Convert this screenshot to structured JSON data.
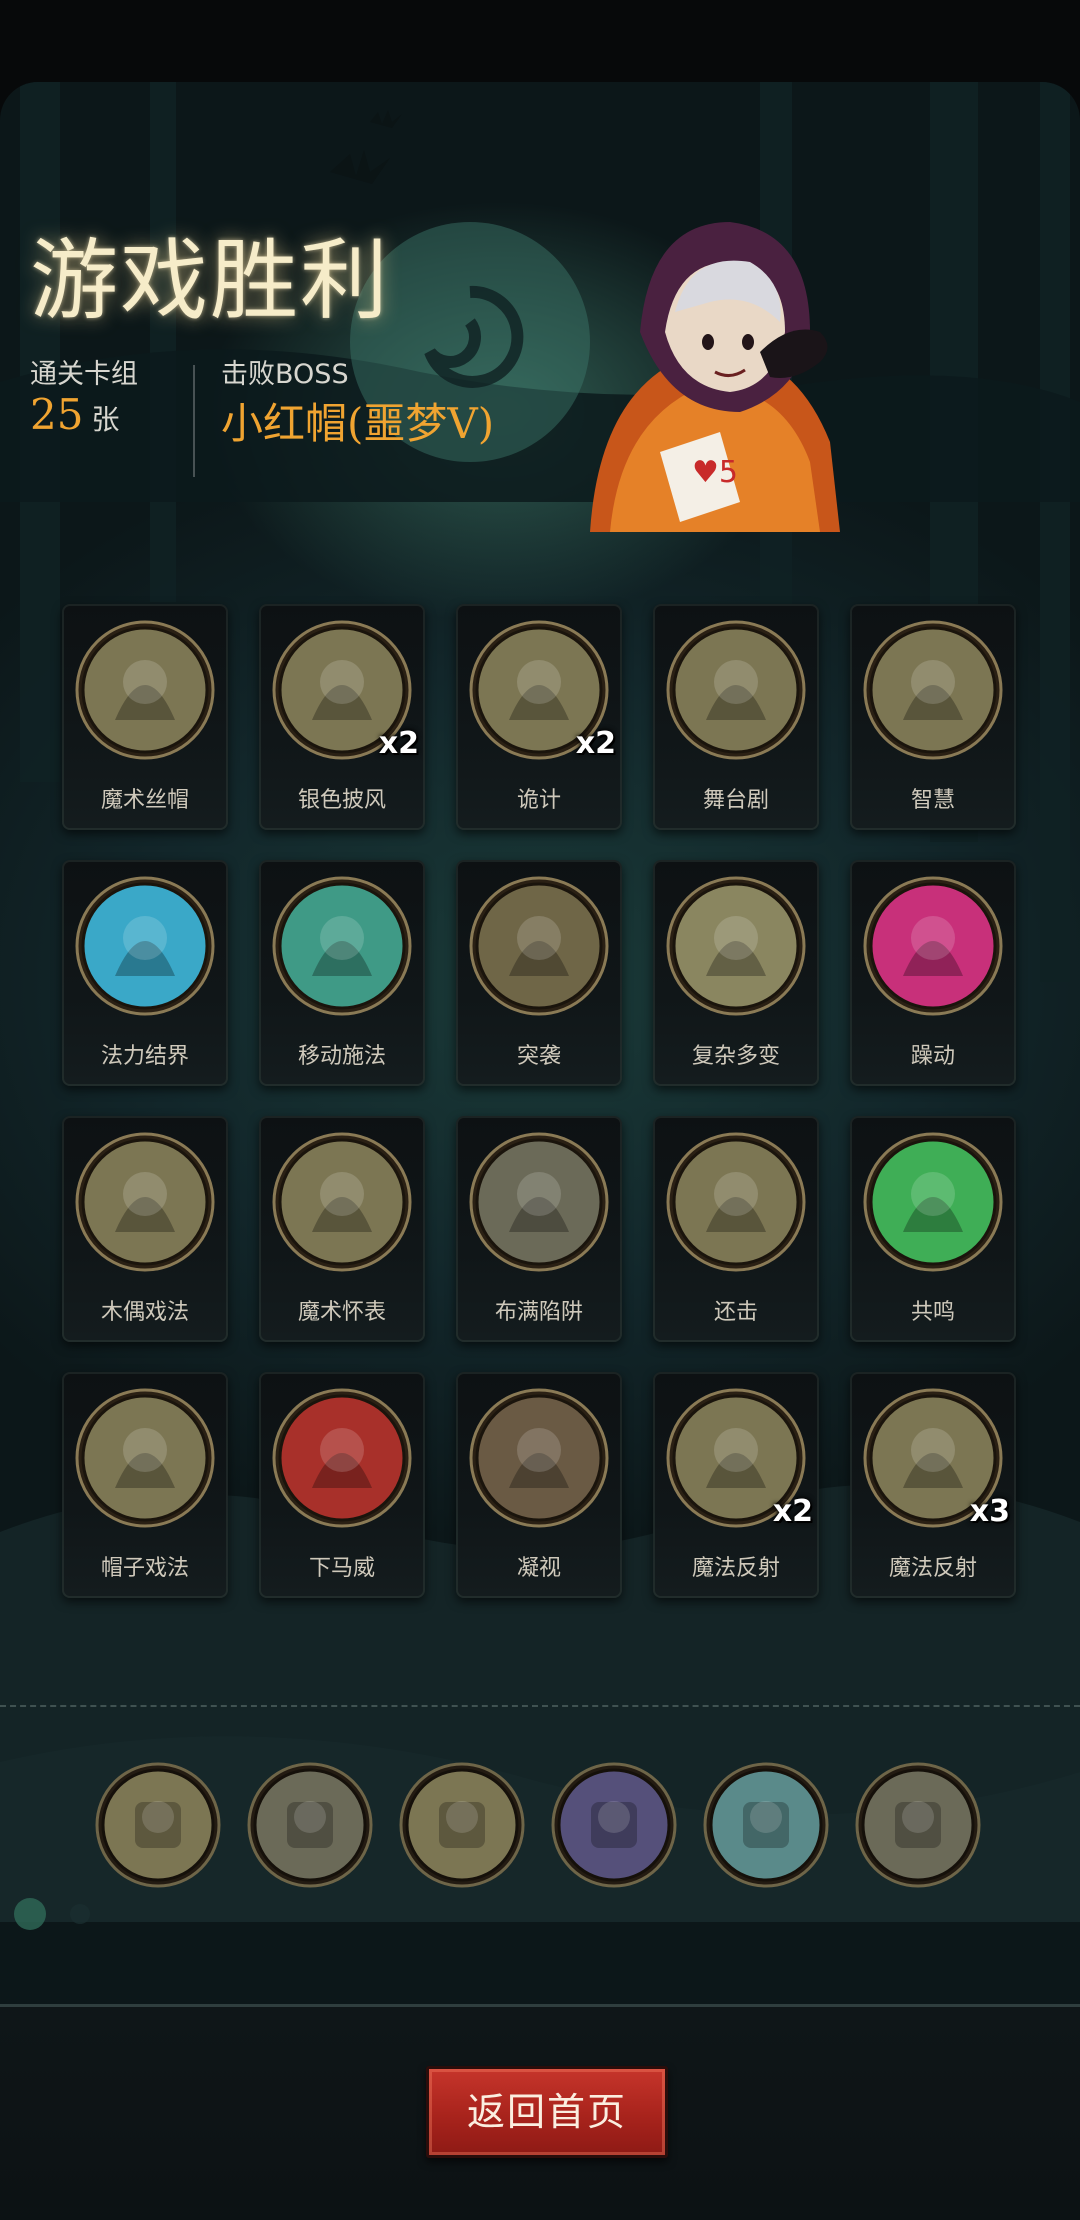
{
  "header": {
    "title": "游戏胜利",
    "deck_label": "通关卡组",
    "deck_count": "25",
    "deck_unit": "张",
    "boss_label": "击败BOSS",
    "boss_name": "小红帽(噩梦V)"
  },
  "cards": [
    {
      "name": "魔术丝帽",
      "multiplier": "",
      "icon": "top-hat-clock-icon",
      "bg": "#7c7653"
    },
    {
      "name": "银色披风",
      "multiplier": "x2",
      "icon": "purple-cloak-icon",
      "bg": "#7c7653"
    },
    {
      "name": "诡计",
      "multiplier": "x2",
      "icon": "card-trickster-icon",
      "bg": "#7c7653"
    },
    {
      "name": "舞台剧",
      "multiplier": "",
      "icon": "stage-play-icon",
      "bg": "#7c7653"
    },
    {
      "name": "智慧",
      "multiplier": "",
      "icon": "scholar-icon",
      "bg": "#7c7653"
    },
    {
      "name": "法力结界",
      "multiplier": "",
      "icon": "mana-barrier-icon",
      "bg": "#3aa8c8"
    },
    {
      "name": "移动施法",
      "multiplier": "",
      "icon": "wizard-casting-icon",
      "bg": "#3f9a86"
    },
    {
      "name": "突袭",
      "multiplier": "",
      "icon": "ambush-icon",
      "bg": "#6f6647"
    },
    {
      "name": "复杂多变",
      "multiplier": "",
      "icon": "green-cube-icon",
      "bg": "#8a8660"
    },
    {
      "name": "躁动",
      "multiplier": "",
      "icon": "restless-energy-icon",
      "bg": "#c8307a"
    },
    {
      "name": "木偶戏法",
      "multiplier": "",
      "icon": "puppet-icon",
      "bg": "#7c7653"
    },
    {
      "name": "魔术怀表",
      "multiplier": "",
      "icon": "pocket-watch-icon",
      "bg": "#7c7653"
    },
    {
      "name": "布满陷阱",
      "multiplier": "",
      "icon": "spike-trap-icon",
      "bg": "#6b6a58"
    },
    {
      "name": "还击",
      "multiplier": "",
      "icon": "counterattack-icon",
      "bg": "#7c7653"
    },
    {
      "name": "共鸣",
      "multiplier": "",
      "icon": "resonance-skulls-icon",
      "bg": "#3fae56"
    },
    {
      "name": "帽子戏法",
      "multiplier": "",
      "icon": "rabbit-hat-icon",
      "bg": "#7c7653"
    },
    {
      "name": "下马威",
      "multiplier": "",
      "icon": "intimidate-icon",
      "bg": "#a8302a"
    },
    {
      "name": "凝视",
      "multiplier": "",
      "icon": "owl-gaze-icon",
      "bg": "#6a5a44"
    },
    {
      "name": "魔法反射",
      "multiplier": "x2",
      "icon": "magic-reflect-icon",
      "bg": "#7c7653"
    },
    {
      "name": "魔法反射",
      "multiplier": "x3",
      "icon": "magic-reflect-icon",
      "bg": "#7c7653"
    }
  ],
  "relics": [
    {
      "icon": "magic-reflect-relic-icon",
      "bg": "#7c7653"
    },
    {
      "icon": "bomb-relic-icon",
      "bg": "#6b6a58"
    },
    {
      "icon": "treasure-chest-relic-icon",
      "bg": "#7c7653"
    },
    {
      "icon": "holy-book-relic-icon",
      "bg": "#55507a"
    },
    {
      "icon": "floating-cards-relic-icon",
      "bg": "#5a8a8a"
    },
    {
      "icon": "hooded-figure-relic-icon",
      "bg": "#6b6a58"
    }
  ],
  "button": {
    "home_label": "返回首页"
  },
  "colors": {
    "accent_orange": "#f0a431",
    "title_cream": "#f6ecc9",
    "button_red": "#b8281f"
  }
}
